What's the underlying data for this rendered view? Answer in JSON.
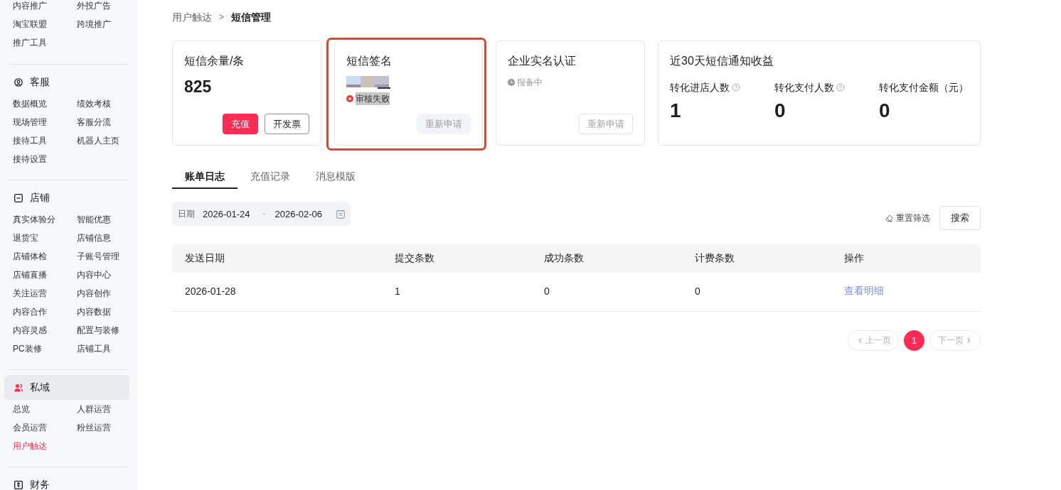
{
  "sidebar": {
    "top_items": [
      {
        "label": "内容推广",
        "selected": false
      },
      {
        "label": "外投广告",
        "selected": false
      },
      {
        "label": "淘宝联盟",
        "selected": false
      },
      {
        "label": "跨境推广",
        "selected": false
      },
      {
        "label": "推广工具",
        "selected": false
      }
    ],
    "sections": [
      {
        "title": "客服",
        "kind": "service",
        "active": false,
        "items": [
          {
            "label": "数据概览",
            "selected": false
          },
          {
            "label": "绩效考核",
            "selected": false
          },
          {
            "label": "现场管理",
            "selected": false
          },
          {
            "label": "客服分流",
            "selected": false
          },
          {
            "label": "接待工具",
            "selected": false
          },
          {
            "label": "机器人主页",
            "selected": false
          },
          {
            "label": "接待设置",
            "selected": false
          }
        ]
      },
      {
        "title": "店铺",
        "kind": "store",
        "active": false,
        "items": [
          {
            "label": "真实体验分",
            "selected": false
          },
          {
            "label": "智能优惠",
            "selected": false
          },
          {
            "label": "退货宝",
            "selected": false
          },
          {
            "label": "店铺信息",
            "selected": false
          },
          {
            "label": "店铺体检",
            "selected": false
          },
          {
            "label": "子账号管理",
            "selected": false
          },
          {
            "label": "店铺直播",
            "selected": false
          },
          {
            "label": "内容中心",
            "selected": false
          },
          {
            "label": "关注运营",
            "selected": false
          },
          {
            "label": "内容创作",
            "selected": false
          },
          {
            "label": "内容合作",
            "selected": false
          },
          {
            "label": "内容数据",
            "selected": false
          },
          {
            "label": "内容灵感",
            "selected": false
          },
          {
            "label": "配置与装修",
            "selected": false
          },
          {
            "label": "PC装修",
            "selected": false
          },
          {
            "label": "店铺工具",
            "selected": false
          }
        ]
      },
      {
        "title": "私域",
        "kind": "private",
        "active": true,
        "items": [
          {
            "label": "总览",
            "selected": false
          },
          {
            "label": "人群运营",
            "selected": false
          },
          {
            "label": "会员运营",
            "selected": false
          },
          {
            "label": "粉丝运营",
            "selected": false
          },
          {
            "label": "用户触达",
            "selected": true
          }
        ]
      },
      {
        "title": "财务",
        "kind": "finance",
        "active": false
      }
    ]
  },
  "breadcrumb": {
    "items": [
      {
        "label": "用户触达",
        "current": false
      },
      {
        "label": "短信管理",
        "current": true
      }
    ],
    "separator": ">"
  },
  "cards": [
    {
      "title": "短信余量/条",
      "value": "825",
      "highlighted": false,
      "buttons": [
        {
          "label": "充值",
          "kind": "primary",
          "disabled": false
        },
        {
          "label": "开发票",
          "kind": "outline",
          "disabled": false
        }
      ]
    },
    {
      "title": "短信签名",
      "name_hidden": true,
      "status": {
        "text": "审核失败",
        "kind": "error",
        "text_selected": true
      },
      "highlighted": true,
      "buttons": [
        {
          "label": "重新申请",
          "kind": "secondary",
          "disabled": true
        }
      ]
    },
    {
      "title": "企业实名认证",
      "status": {
        "text": "报备中",
        "kind": "pending",
        "text_selected": false
      },
      "highlighted": false,
      "buttons": [
        {
          "label": "重新申请",
          "kind": "outline",
          "disabled": true
        }
      ]
    },
    {
      "title": "近30天短信通知收益",
      "highlighted": false,
      "metrics": [
        {
          "label": "转化进店人数",
          "help": true,
          "value": "1"
        },
        {
          "label": "转化支付人数",
          "help": true,
          "value": "0"
        },
        {
          "label": "转化支付金额（元）",
          "help": false,
          "value": "0"
        }
      ]
    }
  ],
  "tabs": [
    {
      "label": "账单日志",
      "selected": true
    },
    {
      "label": "充值记录",
      "selected": false
    },
    {
      "label": "消息模版",
      "selected": false
    }
  ],
  "filter": {
    "date_label": "日期",
    "start": "2026-01-24",
    "separator": "-",
    "end": "2026-02-06",
    "reset": "重置筛选",
    "search": "搜索"
  },
  "table": {
    "columns": [
      {
        "label": "发送日期",
        "kind": "text"
      },
      {
        "label": "提交条数",
        "kind": "text"
      },
      {
        "label": "成功条数",
        "kind": "text"
      },
      {
        "label": "计费条数",
        "kind": "text"
      },
      {
        "label": "操作",
        "kind": "action"
      }
    ],
    "rows": [
      [
        "2026-01-28",
        "1",
        "0",
        "0",
        "查看明细"
      ]
    ]
  },
  "pagination": {
    "previous": {
      "label": "上一页",
      "disabled": true
    },
    "pages": [
      {
        "label": "1",
        "selected": true
      }
    ],
    "next": {
      "label": "下一页",
      "disabled": true
    }
  }
}
